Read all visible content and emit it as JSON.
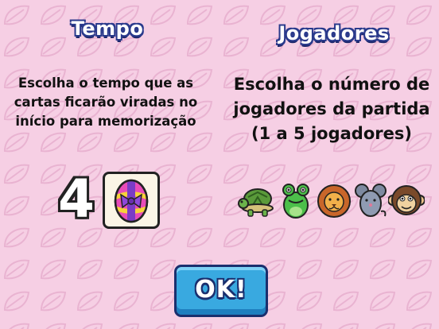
{
  "tempo": {
    "title": "Tempo",
    "description": "Escolha o tempo que as\ncartas  ficarão viradas no\ninício para memorização",
    "value": "4",
    "card_icon": "easter-egg-icon"
  },
  "jogadores": {
    "title": "Jogadores",
    "description": "Escolha o número de\njogadores da partida\n(1 a 5 jogadores)",
    "players": [
      {
        "animal": "turtle-icon"
      },
      {
        "animal": "frog-icon"
      },
      {
        "animal": "lion-icon"
      },
      {
        "animal": "mouse-icon"
      },
      {
        "animal": "monkey-icon"
      }
    ]
  },
  "ok_button": {
    "label": "OK!"
  },
  "colors": {
    "background": "#f6cfe4",
    "leaf_pattern": "#e9b3d1",
    "button": "#39a9e0",
    "title_outline": "#2a3a8c"
  }
}
